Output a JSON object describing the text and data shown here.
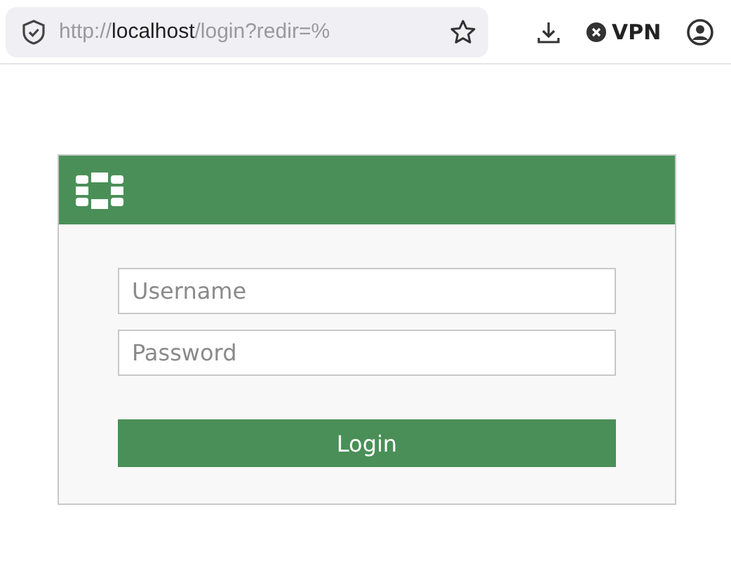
{
  "browser": {
    "url_scheme": "http://",
    "url_host": "localhost",
    "url_path": "/login?redir=%",
    "vpn_label": "VPN"
  },
  "login": {
    "username": {
      "placeholder": "Username"
    },
    "password": {
      "placeholder": "Password"
    },
    "button": "Login"
  }
}
